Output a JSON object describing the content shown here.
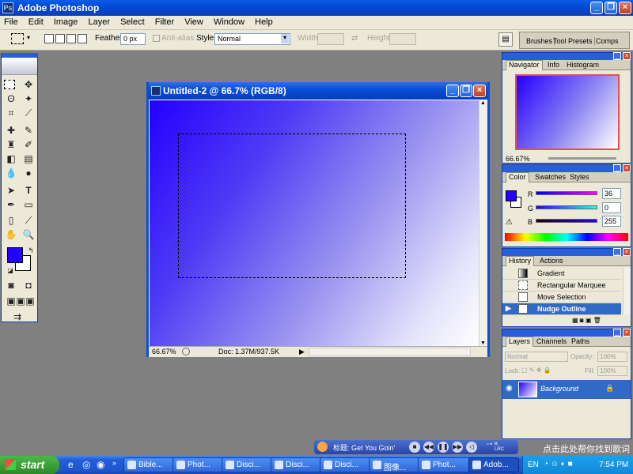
{
  "app": {
    "title": "Adobe Photoshop"
  },
  "menu": [
    "File",
    "Edit",
    "Image",
    "Layer",
    "Select",
    "Filter",
    "View",
    "Window",
    "Help"
  ],
  "options": {
    "feather_label": "Feather:",
    "feather_value": "0 px",
    "antialias_label": "Anti-alias",
    "style_label": "Style:",
    "style_value": "Normal",
    "width_label": "Width:",
    "height_label": "Height:"
  },
  "palette_well": {
    "tabs": [
      "Brushes",
      "Tool Presets",
      "Comps"
    ]
  },
  "document": {
    "title": "Untitled-2 @ 66.7% (RGB/8)",
    "zoom": "66.67%",
    "doc_size": "Doc: 1.37M/937.5K",
    "gradient": {
      "start": "#2400ff",
      "end": "#ffffff"
    }
  },
  "navigator": {
    "tabs": [
      "Navigator",
      "Info",
      "Histogram"
    ],
    "zoom": "66.67%"
  },
  "color_panel": {
    "tabs": [
      "Color",
      "Swatches",
      "Styles"
    ],
    "r_label": "R",
    "r_value": "36",
    "g_label": "G",
    "g_value": "0",
    "b_label": "B",
    "b_value": "255",
    "fg_color": "#2400ff"
  },
  "history": {
    "tabs": [
      "History",
      "Actions"
    ],
    "items": [
      {
        "label": "Gradient"
      },
      {
        "label": "Rectangular Marquee"
      },
      {
        "label": "Move Selection"
      },
      {
        "label": "Nudge Outline"
      }
    ]
  },
  "layers": {
    "tabs": [
      "Layers",
      "Channels",
      "Paths"
    ],
    "blend_mode": "Normal",
    "opacity_label": "Opacity:",
    "opacity_value": "100%",
    "lock_label": "Lock:",
    "fill_label": "Fill:",
    "fill_value": "100%",
    "layer_name": "Background"
  },
  "music_bar": {
    "label": "标题: Get You Goin'",
    "lrc_label": "LRC",
    "tip": "点击此处帮你找到歌词"
  },
  "taskbar": {
    "start_label": "start",
    "tasks": [
      "Bible...",
      "Phot...",
      "Disci...",
      "Disci...",
      "Disci...",
      "图像...",
      "Phot...",
      "Adob..."
    ],
    "lang": "EN",
    "time": "7:54 PM"
  }
}
